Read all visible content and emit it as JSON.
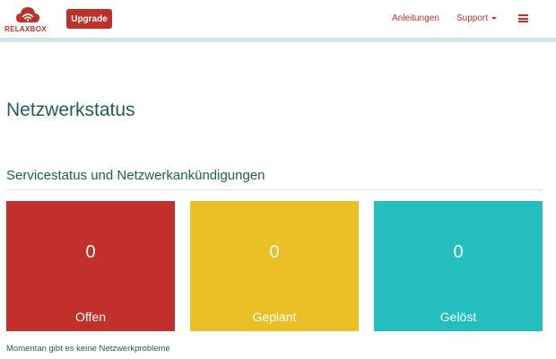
{
  "header": {
    "logo_text": "RELAXBOX",
    "upgrade_label": "Upgrade",
    "nav": {
      "anleitungen": "Anleitungen",
      "support": "Support"
    }
  },
  "main": {
    "title": "Netzwerkstatus",
    "section_title": "Servicestatus und Netzwerkankündigungen",
    "cards": [
      {
        "count": "0",
        "label": "Offen",
        "color": "#c1302a"
      },
      {
        "count": "0",
        "label": "Geplant",
        "color": "#ebc026"
      },
      {
        "count": "0",
        "label": "Gelöst",
        "color": "#25bebf"
      }
    ],
    "status_message": "Momentan gibt es keine Netzwerkprobleme"
  },
  "colors": {
    "brand": "#c0302a",
    "heading": "#1f5d5c",
    "header_stripe": "#cfe6ea"
  },
  "icons": {
    "logo": "cloud-wifi-icon",
    "menu": "hamburger-icon",
    "dropdown": "caret-down-icon"
  }
}
